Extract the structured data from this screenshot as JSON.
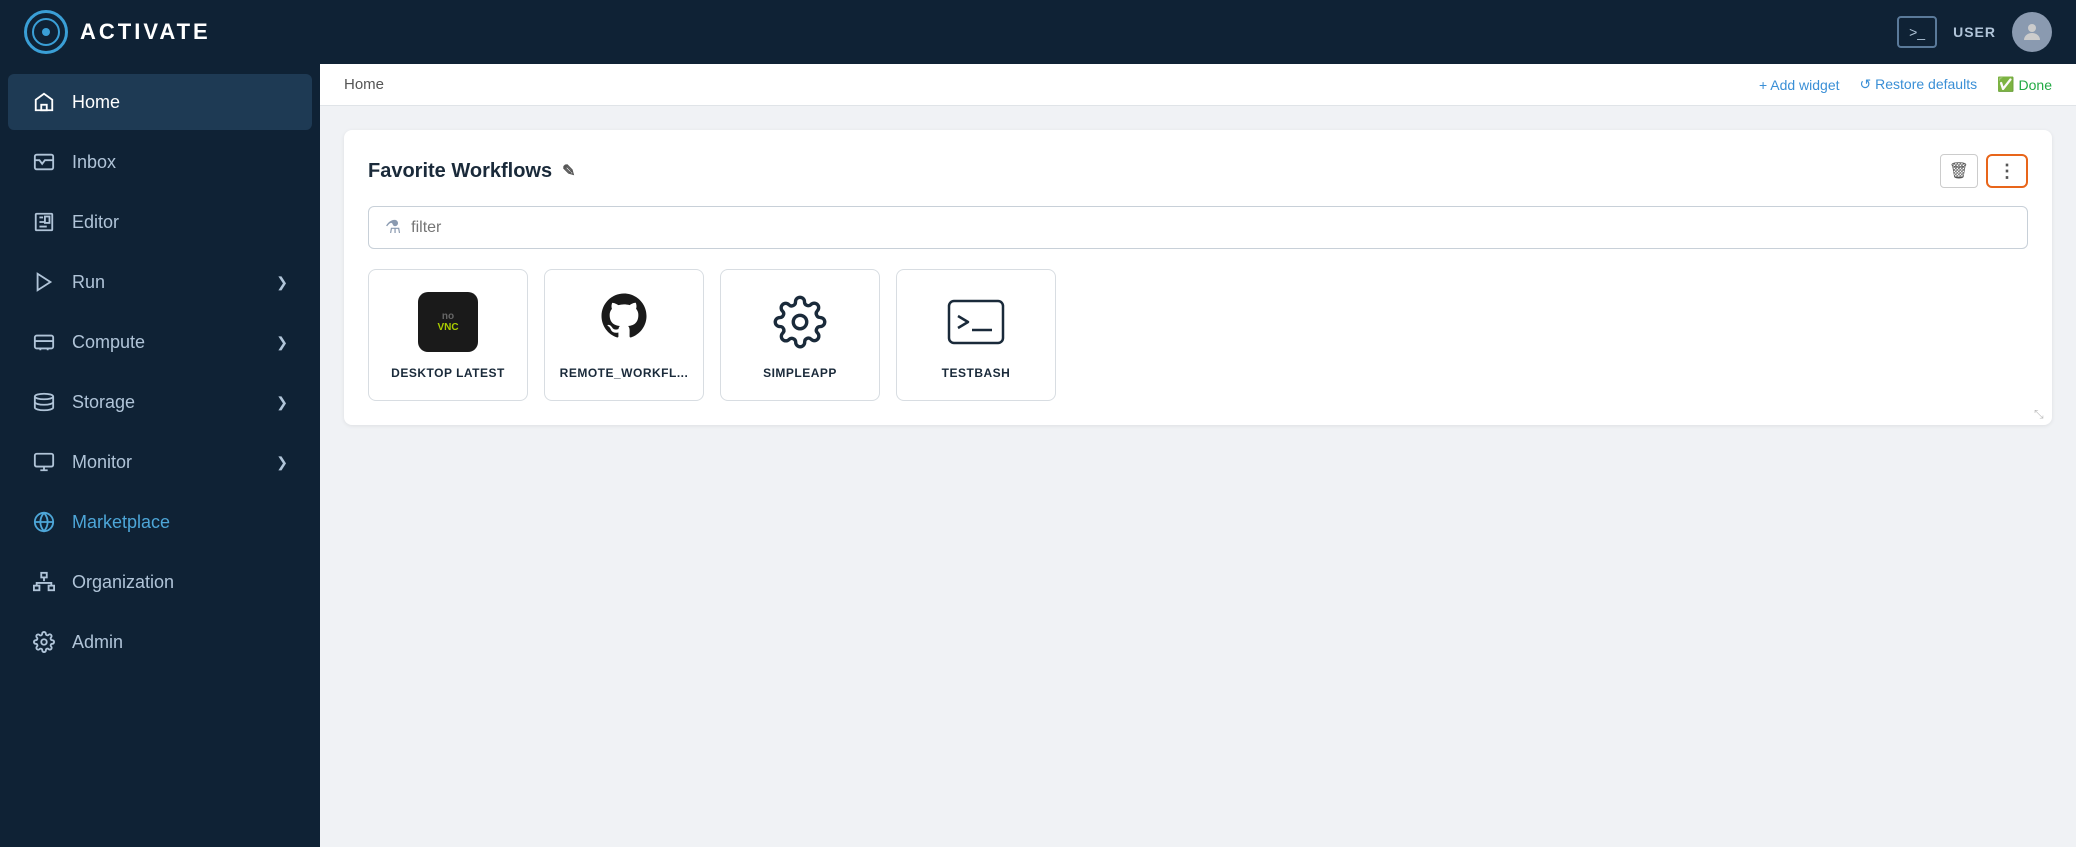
{
  "app": {
    "title": "ACTIVATE",
    "logo_alt": "Activate Logo"
  },
  "topnav": {
    "terminal_label": ">_",
    "user_label": "USER"
  },
  "sidebar": {
    "items": [
      {
        "id": "home",
        "label": "Home",
        "icon": "home-icon",
        "active": true,
        "expandable": false
      },
      {
        "id": "inbox",
        "label": "Inbox",
        "icon": "inbox-icon",
        "active": false,
        "expandable": false
      },
      {
        "id": "editor",
        "label": "Editor",
        "icon": "editor-icon",
        "active": false,
        "expandable": false
      },
      {
        "id": "run",
        "label": "Run",
        "icon": "run-icon",
        "active": false,
        "expandable": true
      },
      {
        "id": "compute",
        "label": "Compute",
        "icon": "compute-icon",
        "active": false,
        "expandable": true
      },
      {
        "id": "storage",
        "label": "Storage",
        "icon": "storage-icon",
        "active": false,
        "expandable": true
      },
      {
        "id": "monitor",
        "label": "Monitor",
        "icon": "monitor-icon",
        "active": false,
        "expandable": true
      },
      {
        "id": "marketplace",
        "label": "Marketplace",
        "icon": "marketplace-icon",
        "active": false,
        "expandable": false
      },
      {
        "id": "organization",
        "label": "Organization",
        "icon": "organization-icon",
        "active": false,
        "expandable": false
      },
      {
        "id": "admin",
        "label": "Admin",
        "icon": "admin-icon",
        "active": false,
        "expandable": false
      }
    ]
  },
  "header": {
    "breadcrumb": "Home",
    "add_widget_label": "+ Add widget",
    "restore_defaults_label": "↺ Restore defaults",
    "done_label": "Done"
  },
  "widget": {
    "title": "Favorite Workflows",
    "title_icon": "✎",
    "filter_placeholder": "filter",
    "workflows": [
      {
        "id": "desktop-latest",
        "label": "DESKTOP LATEST",
        "icon_type": "novnc"
      },
      {
        "id": "remote-workfl",
        "label": "REMOTE_WORKFL...",
        "icon_type": "github"
      },
      {
        "id": "simpleapp",
        "label": "SIMPLEAPP",
        "icon_type": "gear"
      },
      {
        "id": "testbash",
        "label": "TESTBASH",
        "icon_type": "terminal"
      }
    ]
  }
}
